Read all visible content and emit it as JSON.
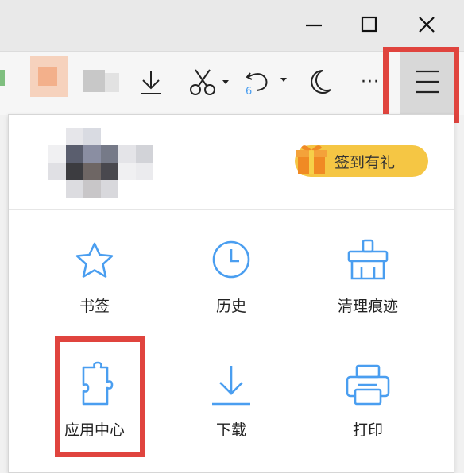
{
  "window": {
    "controls": [
      {
        "name": "minimize-button",
        "icon": "minimize-icon"
      },
      {
        "name": "maximize-button",
        "icon": "maximize-icon"
      },
      {
        "name": "close-button",
        "icon": "close-icon"
      }
    ]
  },
  "toolbar": {
    "undo_badge": "6",
    "more_glyph": "···",
    "icons": [
      "download-icon",
      "scissors-icon",
      "undo-icon",
      "moon-icon",
      "more-icon",
      "hamburger-menu-icon"
    ]
  },
  "menu": {
    "checkin_label": "签到有礼",
    "items": [
      {
        "label": "书签",
        "icon": "star-icon"
      },
      {
        "label": "历史",
        "icon": "clock-icon"
      },
      {
        "label": "清理痕迹",
        "icon": "broom-icon"
      },
      {
        "label": "应用中心",
        "icon": "puzzle-icon"
      },
      {
        "label": "下载",
        "icon": "download-icon"
      },
      {
        "label": "打印",
        "icon": "printer-icon"
      }
    ]
  },
  "colors": {
    "accent_blue": "#4a9ef0",
    "highlight_red": "#e0443e",
    "checkin_yellow": "#f5c644",
    "gift_orange": "#f08a24"
  }
}
